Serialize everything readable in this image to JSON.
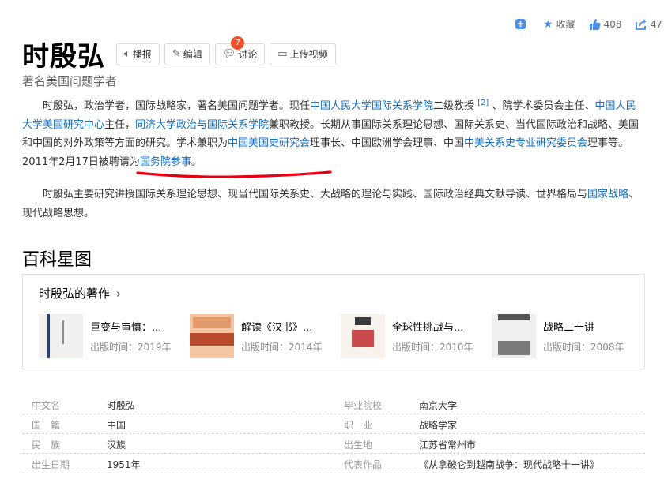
{
  "header": {
    "title": "时殷弘",
    "subtitle": "著名美国问题学者",
    "buttons": {
      "broadcast": "播报",
      "edit": "编辑",
      "discuss": "讨论",
      "discuss_badge": "7",
      "upload_video": "上传视频"
    },
    "actions": {
      "favorite": "收藏",
      "like_count": "408",
      "share_count": "47"
    }
  },
  "summary": {
    "p1": {
      "t1": "时殷弘，政治学者，国际战略家，著名美国问题学者。现任",
      "l1": "中国人民大学国际关系学院",
      "t2": "二级教授 ",
      "ref": "[2]",
      "t3": " 、院学术委员会主任、",
      "l2": "中国人民大学美国研究中心",
      "t4": "主任，",
      "l3": "同济大学政治与国际关系学院",
      "t5": "兼职教授。长期从事国际关系理论思想、国际关系史、当代国际政治和战略、美国和中国的对外政策等方面的研究。学术兼职为",
      "l4": "中国美国史研究会",
      "t6": "理事长、中国欧洲学会理事、中国",
      "l5": "中美关系史专业研究委员会",
      "t7": "理事等。",
      "t8": "2011年2月17日被聘请为",
      "l6": "国务院参事",
      "t9": "。"
    },
    "p2": {
      "t1": "时殷弘主要研究讲授国际关系理论思想、现当代国际关系史、大战略的理论与实践、国际政治经典文献导读、世界格局与",
      "l1": "国家战略",
      "t2": "、现代战略思想。"
    }
  },
  "section_title": "百科星图",
  "works": {
    "heading": "时殷弘的著作",
    "date_label": "出版时间：",
    "books": [
      {
        "title": "巨变与审慎：...",
        "date": "2019年"
      },
      {
        "title": "解读《汉书》...",
        "date": "2014年"
      },
      {
        "title": "全球性挑战与...",
        "date": "2010年"
      },
      {
        "title": "战略二十讲",
        "date": "2008年"
      }
    ]
  },
  "info": {
    "rows": [
      {
        "l1": "中文名",
        "v1": "时殷弘",
        "l2": "毕业院校",
        "v2": "南京大学"
      },
      {
        "l1": "国　籍",
        "v1": "中国",
        "l2": "职　业",
        "v2": "战略学家"
      },
      {
        "l1": "民　族",
        "v1": "汉族",
        "l2": "出生地",
        "v2": "江苏省常州市"
      },
      {
        "l1": "出生日期",
        "v1": "1951年",
        "l2": "代表作品",
        "v2": "《从拿破仑到越南战争：现代战略十一讲》"
      }
    ]
  },
  "colors": {
    "link": "#136ec2",
    "accent": "#4d8fe8",
    "badge": "#f04f2b",
    "annotation": "#e60012"
  }
}
